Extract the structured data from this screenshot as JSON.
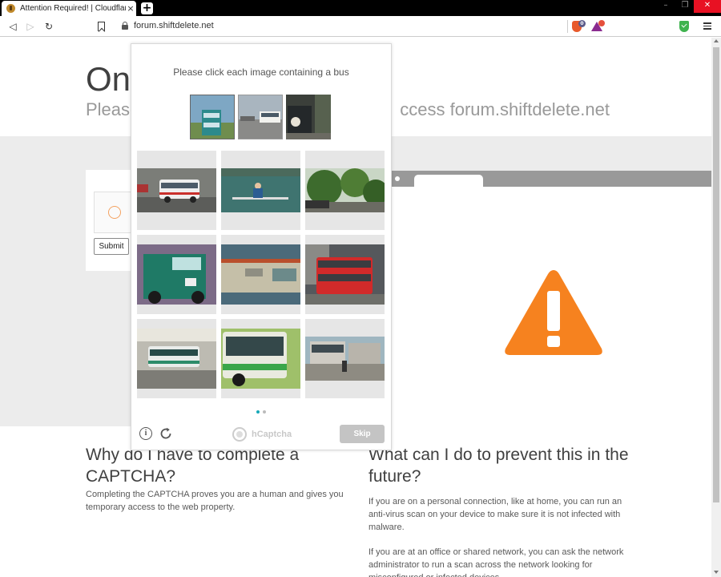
{
  "browser": {
    "tab_title": "Attention Required! | Cloudflare",
    "tab_close": "×",
    "new_tab": "+",
    "url": "forum.shiftdelete.net",
    "brave_badge": "0"
  },
  "page": {
    "heading": "On",
    "subheading_left": "Please",
    "subheading_right": "ccess forum.shiftdelete.net",
    "submit_label": "Submit",
    "faq_left": {
      "title": "Why do I have to complete a CAPTCHA?",
      "body": "Completing the CAPTCHA proves you are a human and gives you temporary access to the web property."
    },
    "faq_right": {
      "title": "What can I do to prevent this in the future?",
      "body_1": "If you are on a personal connection, like at home, you can run an anti-virus scan on your device to make sure it is not infected with malware.",
      "body_2": "If you are at an office or shared network, you can ask the network administrator to run a scan across the network looking for misconfigured or infected devices."
    }
  },
  "challenge": {
    "prompt": "Please click each image containing a bus",
    "skip_label": "Skip",
    "brand": "hCaptcha",
    "info_glyph": "i",
    "examples": [
      "example-bus-1",
      "example-bus-2",
      "example-bus-3"
    ],
    "tiles": [
      "tile-white-bus-street",
      "tile-kayaker",
      "tile-trees-road",
      "tile-green-truck",
      "tile-bus-closeup",
      "tile-red-double-decker",
      "tile-green-white-bus",
      "tile-bus-front",
      "tile-parked-coaches"
    ],
    "pager_active": 1,
    "pager_total": 2
  },
  "colors": {
    "accent": "#f6821f",
    "pager_active": "#17a8b8",
    "skip_bg": "#c4c4c4"
  }
}
